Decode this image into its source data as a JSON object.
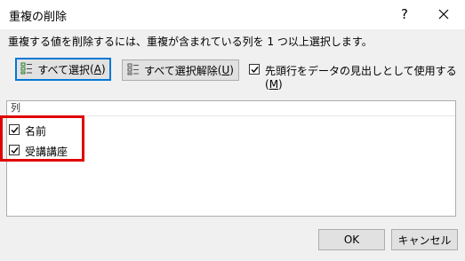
{
  "window": {
    "title": "重複の削除"
  },
  "instruction": "重複する値を削除するには、重複が含まれている列を 1 つ以上選択します。",
  "buttons": {
    "select_all": {
      "label": "すべて選択",
      "accel": "A"
    },
    "unselect_all": {
      "label": "すべて選択解除",
      "accel": "U"
    },
    "ok": "OK",
    "cancel": "キャンセル"
  },
  "header_checkbox": {
    "label": "先頭行をデータの見出しとして使用する",
    "accel": "M",
    "checked": true
  },
  "columns": {
    "header": "列",
    "items": [
      {
        "label": "名前",
        "checked": true
      },
      {
        "label": "受講講座",
        "checked": true
      }
    ]
  },
  "colors": {
    "focus_border": "#0078d7",
    "annotation_red": "#e00000"
  },
  "icons": [
    "help-icon",
    "close-icon",
    "select-all-icon",
    "unselect-all-icon",
    "checkmark-icon"
  ]
}
